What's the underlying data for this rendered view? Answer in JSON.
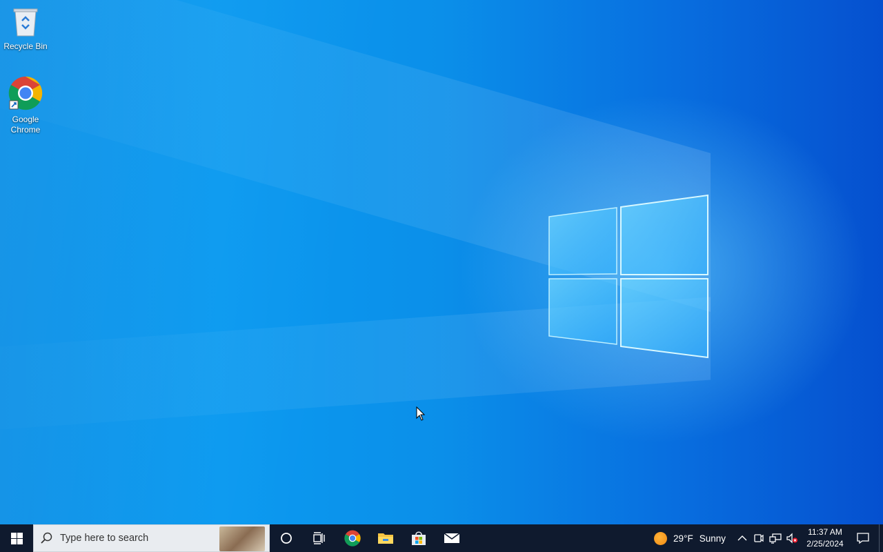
{
  "desktop": {
    "wallpaper": "Windows 10 light-beam wallpaper",
    "icons": [
      {
        "label": "Recycle Bin",
        "icon": "recycle-bin-icon"
      },
      {
        "label": "Google Chrome",
        "icon": "chrome-icon"
      }
    ]
  },
  "taskbar": {
    "search": {
      "placeholder": "Type here to search"
    },
    "apps": [
      {
        "name": "Cortana",
        "icon": "cortana-icon"
      },
      {
        "name": "Task View",
        "icon": "task-view-icon"
      },
      {
        "name": "Google Chrome",
        "icon": "chrome-icon"
      },
      {
        "name": "File Explorer",
        "icon": "folder-icon"
      },
      {
        "name": "Microsoft Store",
        "icon": "store-icon"
      },
      {
        "name": "Mail",
        "icon": "mail-icon"
      }
    ],
    "weather": {
      "temp": "29°F",
      "condition": "Sunny"
    },
    "clock": {
      "time": "11:37 AM",
      "date": "2/25/2024"
    }
  },
  "colors": {
    "taskbar": "#0f1a2e",
    "search_bg": "#e9ecf0",
    "wallpaper_accent": "#0b8fe9"
  }
}
